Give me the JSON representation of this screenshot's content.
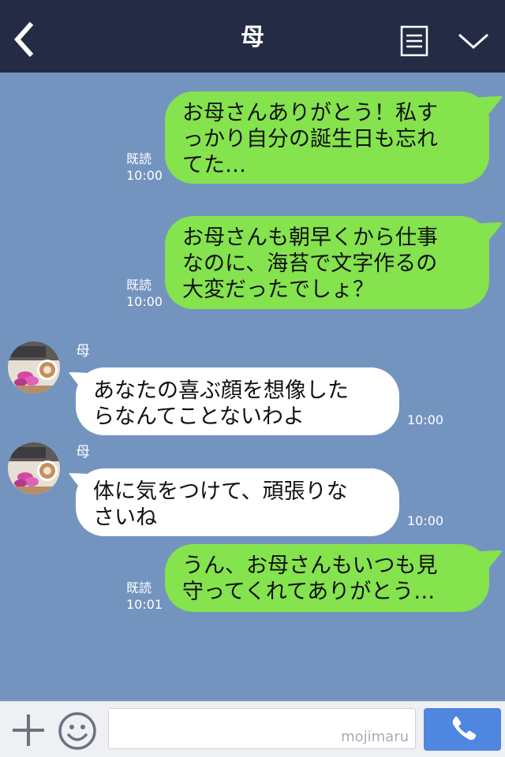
{
  "header": {
    "title": "母",
    "back_icon": "chevron-left-icon",
    "menu_icon": "notes-icon",
    "expand_icon": "chevron-down-icon"
  },
  "messages": [
    {
      "side": "sent",
      "text": "お母さんありがとう！私す\nっかり自分の誕生日も忘れ\nてた…",
      "read": "既読",
      "time": "10:00"
    },
    {
      "side": "sent",
      "text": "お母さんも朝早くから仕事\nなのに、海苔で文字作るの\n大変だったでしょ？",
      "read": "既読",
      "time": "10:00"
    },
    {
      "side": "received",
      "sender": "母",
      "text": "あなたの喜ぶ顔を想像した\nらなんてことないわよ",
      "time": "10:00"
    },
    {
      "side": "received",
      "sender": "母",
      "text": "体に気をつけて、頑張りな\nさいね",
      "time": "10:00"
    },
    {
      "side": "sent",
      "text": "うん、お母さんもいつも見\n守ってくれてありがとう…",
      "read": "既読",
      "time": "10:01"
    }
  ],
  "footer": {
    "plus_icon": "plus-icon",
    "emoji_icon": "smiley-icon",
    "input_value": "",
    "watermark": "mojimaru",
    "call_icon": "phone-icon"
  },
  "colors": {
    "header_bg": "#242c45",
    "chat_bg": "#7494c0",
    "sent_bubble": "#85e34e",
    "received_bubble": "#ffffff",
    "call_button": "#4e86e0"
  }
}
